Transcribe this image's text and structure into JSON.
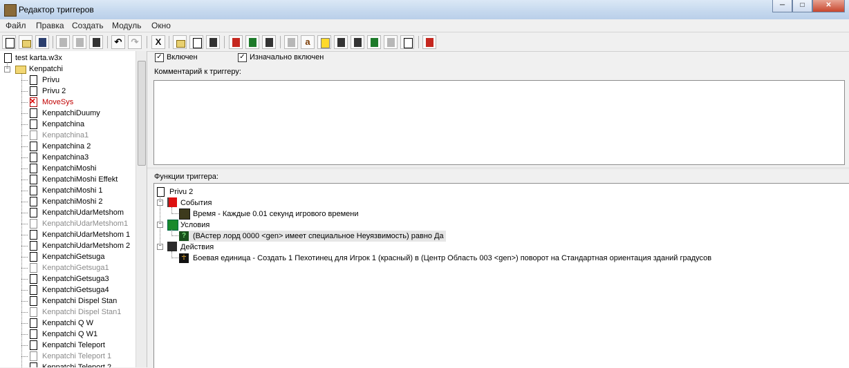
{
  "window": {
    "title": "Редактор триггеров",
    "controls": {
      "minimize": "─",
      "maximize": "□",
      "close": "✕"
    }
  },
  "menu": [
    "Файл",
    "Правка",
    "Создать",
    "Модуль",
    "Окно"
  ],
  "toolbar": {
    "glyph_x": "X",
    "glyph_a": "a",
    "undo": "↶",
    "redo": "↷"
  },
  "tree": {
    "root": "test karta.w3x",
    "folder": "Kenpatchi",
    "items": [
      {
        "label": "Privu",
        "state": "normal"
      },
      {
        "label": "Privu 2",
        "state": "normal"
      },
      {
        "label": "MoveSys",
        "state": "error"
      },
      {
        "label": "KenpatchiDuumy",
        "state": "normal"
      },
      {
        "label": "Kenpatchina",
        "state": "normal"
      },
      {
        "label": "Kenpatchina1",
        "state": "disabled"
      },
      {
        "label": "Kenpatchina 2",
        "state": "normal"
      },
      {
        "label": "Kenpatchina3",
        "state": "normal"
      },
      {
        "label": "KenpatchiMoshi",
        "state": "normal"
      },
      {
        "label": "KenpatchiMoshi Effekt",
        "state": "normal"
      },
      {
        "label": "KenpatchiMoshi 1",
        "state": "normal"
      },
      {
        "label": "KenpatchiMoshi 2",
        "state": "normal"
      },
      {
        "label": "KenpatchiUdarMetshom",
        "state": "normal"
      },
      {
        "label": "KenpatchiUdarMetshom1",
        "state": "disabled"
      },
      {
        "label": "KenpatchiUdarMetshom 1",
        "state": "normal"
      },
      {
        "label": "KenpatchiUdarMetshom 2",
        "state": "normal"
      },
      {
        "label": "KenpatchiGetsuga",
        "state": "normal"
      },
      {
        "label": "KenpatchiGetsuga1",
        "state": "disabled"
      },
      {
        "label": "KenpatchiGetsuga3",
        "state": "normal"
      },
      {
        "label": "KenpatchiGetsuga4",
        "state": "normal"
      },
      {
        "label": "Kenpatchi Dispel Stan",
        "state": "normal"
      },
      {
        "label": "Kenpatchi Dispel Stan1",
        "state": "disabled"
      },
      {
        "label": "Kenpatchi Q W",
        "state": "normal"
      },
      {
        "label": "Kenpatchi Q W1",
        "state": "normal"
      },
      {
        "label": "Kenpatchi Teleport",
        "state": "normal"
      },
      {
        "label": "Kenpatchi Teleport 1",
        "state": "disabled"
      },
      {
        "label": "Kenpatchi Teleport 2",
        "state": "normal"
      }
    ]
  },
  "trigger": {
    "enabled_label": "Включен",
    "enabled": true,
    "initially_on_label": "Изначально включен",
    "initially_on": true,
    "comment_label": "Комментарий к триггеру:",
    "comment_value": "",
    "functions_label": "Функции триггера:",
    "name": "Privu 2",
    "events_label": "События",
    "event": "Время - Каждые 0.01 секунд игрового времени",
    "conditions_label": "Условия",
    "condition": "(ВАстер лорд 0000 <gen> имеет специальное Неуязвимость) равно Да",
    "actions_label": "Действия",
    "action": "Боевая единица - Создать 1 Пехотинец для Игрок 1 (красный) в (Центр Область 003 <gen>) поворот на Стандартная ориентация зданий градусов"
  }
}
